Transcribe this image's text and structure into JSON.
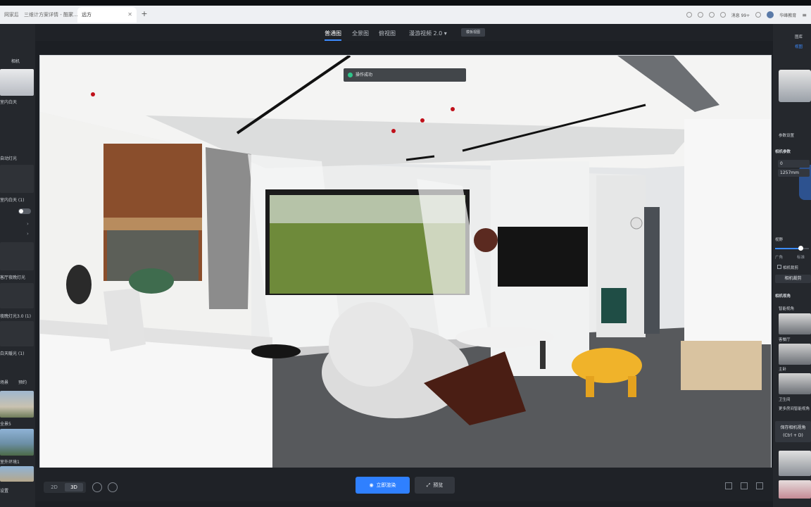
{
  "browser": {
    "tabs": [
      {
        "label": "网家后台"
      },
      {
        "label": "三维计方案详情 - 酷家..."
      },
      {
        "label": "远方"
      }
    ],
    "new_tab_label": "+",
    "right": {
      "notices": "消息 99+",
      "user": "华峰教育"
    }
  },
  "header": {
    "view_tabs": [
      "普通图",
      "全景图",
      "俯视图",
      "漫游视频 2.0 ▾"
    ],
    "mode_button": "模板视图"
  },
  "toast": {
    "text": "操作成功"
  },
  "left_sidebar": {
    "section_title": "相机",
    "items": [
      {
        "label": "室内白天"
      },
      {
        "label": "自动灯光"
      },
      {
        "label": "室内白天 (1)"
      },
      {
        "label": "客厅夜晚灯光"
      },
      {
        "label": "夜晚灯光3.0 (1)"
      },
      {
        "label": "白天暖光 (1)"
      }
    ],
    "bottom_tabs": [
      "场景",
      "预约"
    ],
    "thumbs": [
      {
        "label": "全景5"
      },
      {
        "label": "室外环境1"
      },
      {
        "label": "设置"
      }
    ]
  },
  "bottom_bar": {
    "mode_2d": "2D",
    "mode_3d": "3D",
    "render_button": "立即渲染",
    "preview_button": "预览"
  },
  "right_panel": {
    "top_tabs": [
      "图库",
      "视图"
    ],
    "params_title": "参数设置",
    "camera_params_title": "相机参数",
    "angle_value": "0",
    "focal_value": "1257mm",
    "fov_title": "视野",
    "fov_labels": [
      "广角",
      "标准"
    ],
    "fov_level": 0.75,
    "camera_clip_label": "相机裁剪",
    "clip_button": "相机裁剪",
    "camera_view_title": "相机视角",
    "smart_view_title": "智能视角",
    "views": [
      {
        "label": "客餐厅"
      },
      {
        "label": "主卧"
      },
      {
        "label": "卫生间"
      }
    ],
    "more_views": "更多房间智能视角",
    "save_button": "保存相机视角\n(Ctrl + D)"
  },
  "colors": {
    "accent": "#2f80ff",
    "panel_bg": "#25282d",
    "success": "#2fc48a"
  }
}
